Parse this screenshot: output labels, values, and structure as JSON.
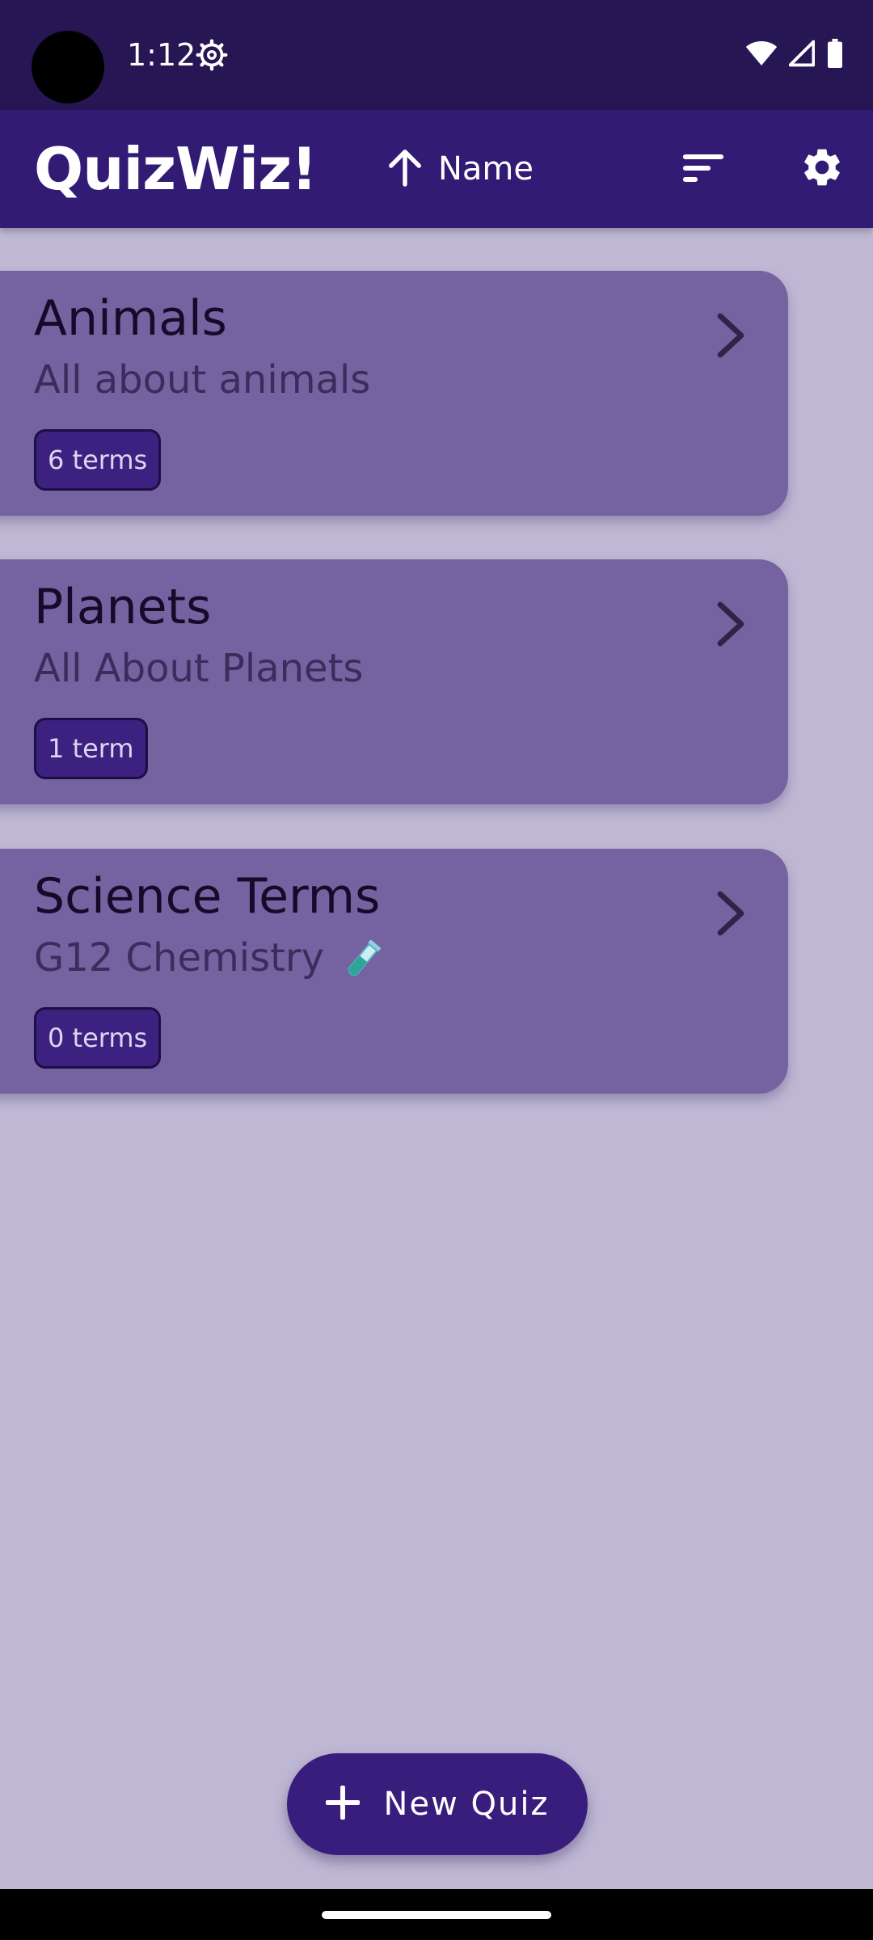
{
  "status_bar": {
    "time": "1:12",
    "icons": [
      "settings-gear-icon",
      "wifi-icon",
      "cell-signal-icon",
      "battery-icon"
    ]
  },
  "app_bar": {
    "title": "QuizWiz!",
    "sort_direction_icon": "arrow-up-icon",
    "sort_label": "Name",
    "filter_icon": "sort-lines-icon",
    "settings_icon": "gear-icon"
  },
  "quizzes": [
    {
      "title": "Animals",
      "description": "All about animals",
      "terms": "6 terms"
    },
    {
      "title": "Planets",
      "description": "All About Planets",
      "terms": "1 term"
    },
    {
      "title": "Science Terms",
      "description": "G12 Chemistry",
      "description_emoji": "test-tube-icon",
      "terms": "0 terms"
    }
  ],
  "fab": {
    "icon": "plus-icon",
    "label": "New Quiz"
  },
  "colors": {
    "status_bar": "#271654",
    "app_bar": "#311b74",
    "background": "#bfb8d4",
    "card": "#7463a0",
    "badge": "#3c2180",
    "fab": "#381d7c"
  }
}
